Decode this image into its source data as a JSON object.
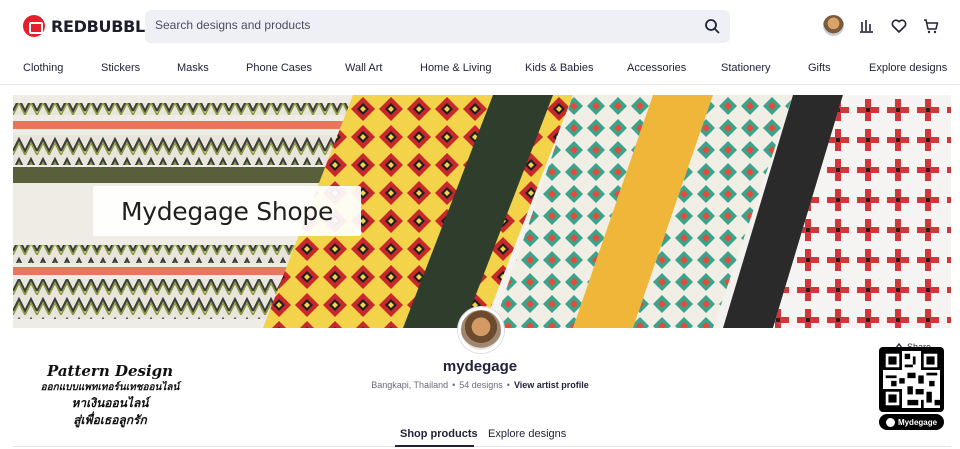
{
  "header": {
    "logo_text": "REDBUBBLE",
    "search_placeholder": "Search designs and products"
  },
  "nav": {
    "items": [
      "Clothing",
      "Stickers",
      "Masks",
      "Phone Cases",
      "Wall Art",
      "Home & Living",
      "Kids & Babies",
      "Accessories",
      "Stationery",
      "Gifts",
      "Explore designs"
    ]
  },
  "banner": {
    "title": "Mydegage Shope"
  },
  "profile": {
    "name": "mydegage",
    "location": "Bangkapi, Thailand",
    "designs": "54 designs",
    "profile_link": "View artist profile",
    "share": "Share"
  },
  "promo": {
    "title": "Pattern Design",
    "line1": "ออกแบบแพทเทอร์นเทชออนไลน์",
    "line2": "หาเงินออนไลน์",
    "line3": "สู่เพื่อเธอลูกรัก",
    "qr_label": "Mydegage"
  },
  "tabs": {
    "shop": "Shop products",
    "explore": "Explore designs"
  },
  "colors": {
    "accent": "#e4202c",
    "text": "#22223a",
    "search_bg": "#eef0f5"
  }
}
